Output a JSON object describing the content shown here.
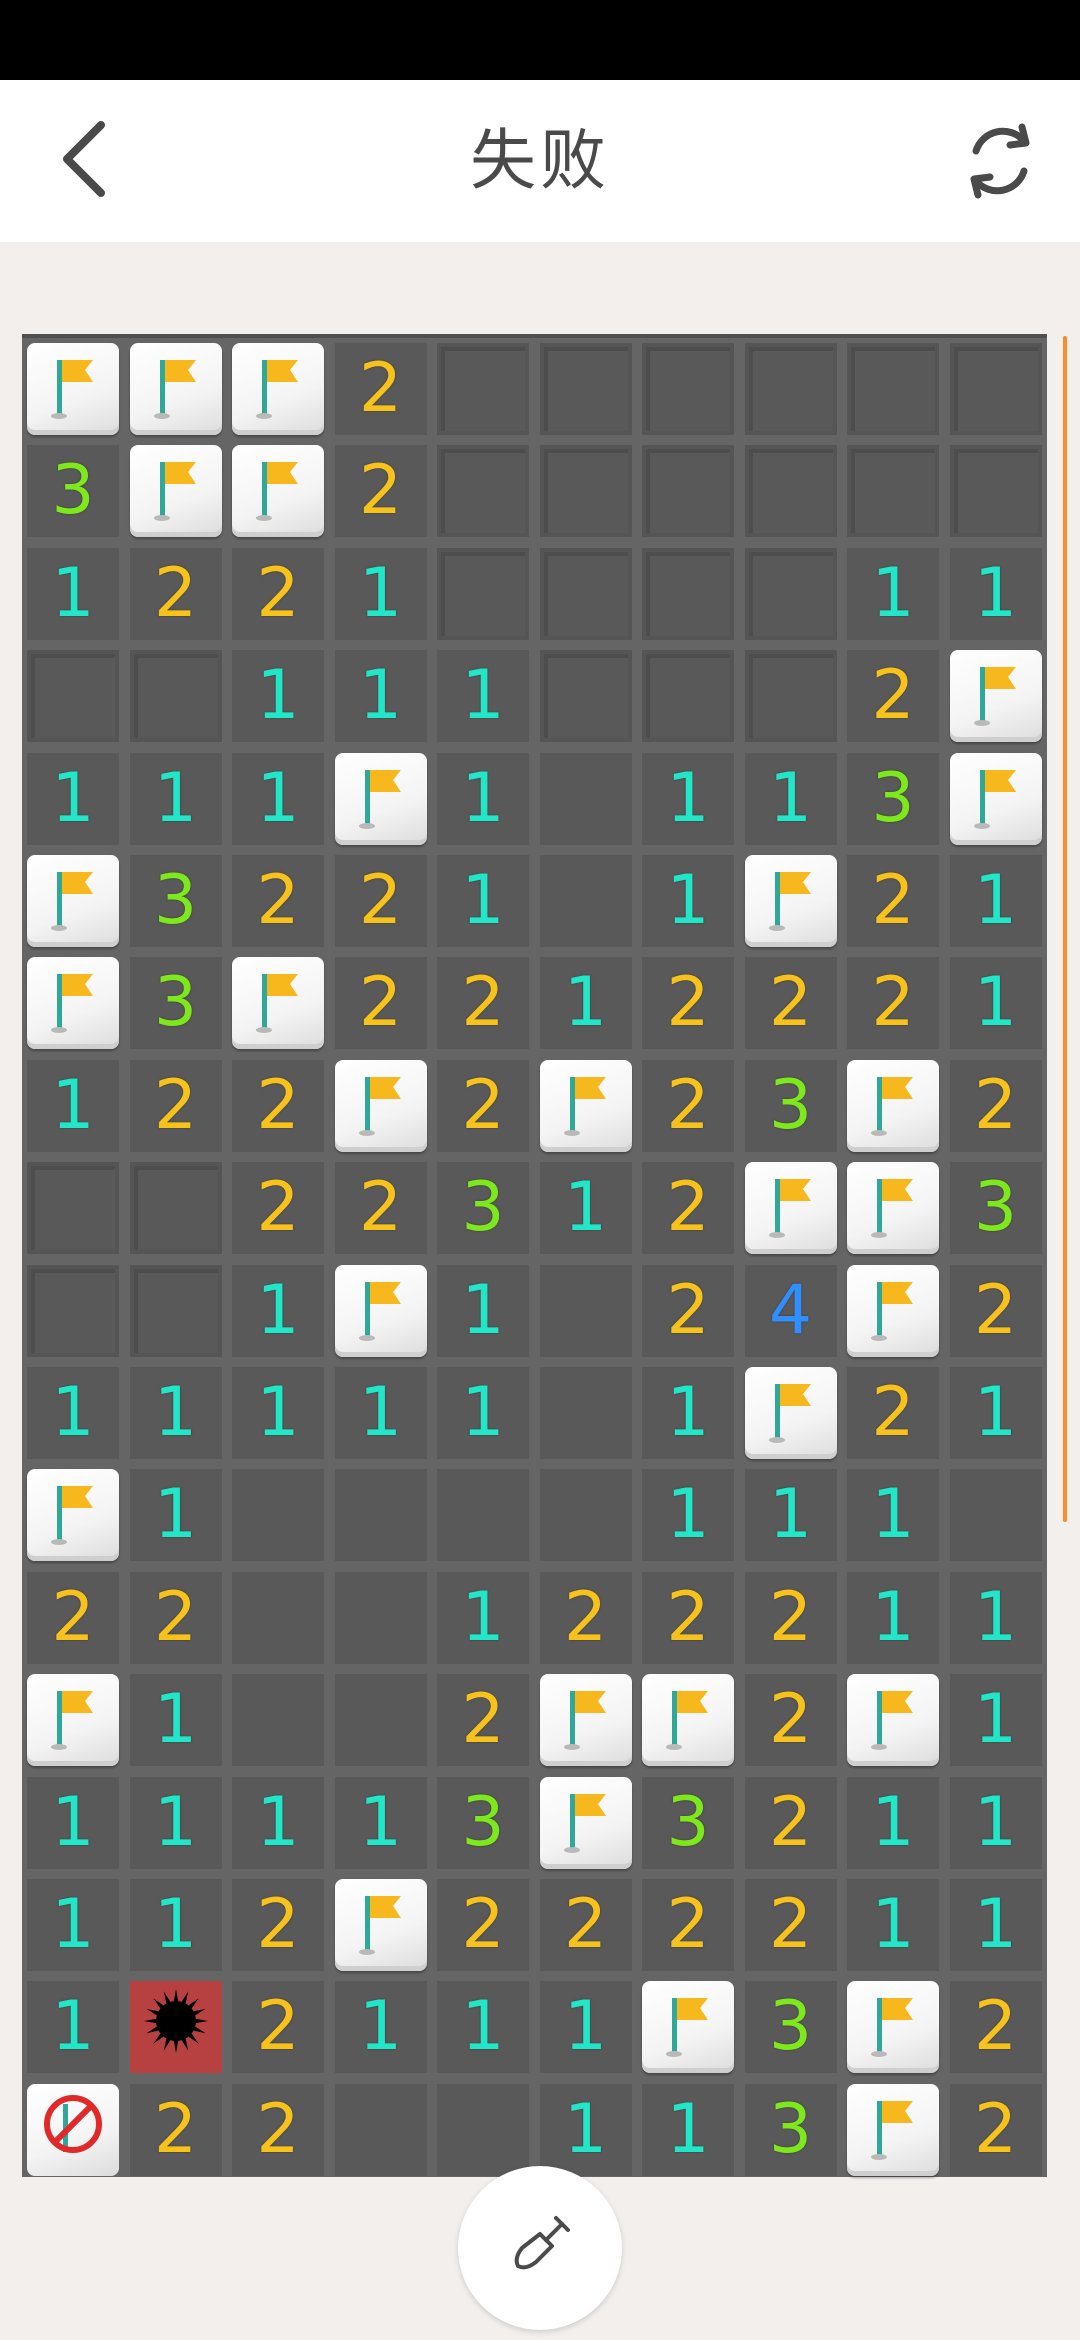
{
  "header": {
    "title": "失败",
    "back_icon": "chevron-left-icon",
    "restart_icon": "refresh-icon"
  },
  "colors": {
    "1": "#22e6c8",
    "2": "#f7c21b",
    "3": "#7de81c",
    "4": "#2f8fff",
    "flag": "#f7b81e",
    "mine_background": "#b74040"
  },
  "board": {
    "columns": 10,
    "rows": 18,
    "legend": "F = flagged, X = exploded mine, W = wrong flag, . = covered, _ = revealed empty",
    "grid": [
      [
        "F",
        "F",
        "F",
        "2",
        ".",
        ".",
        ".",
        ".",
        ".",
        "."
      ],
      [
        "3",
        "F",
        "F",
        "2",
        ".",
        ".",
        ".",
        ".",
        ".",
        "."
      ],
      [
        "1",
        "2",
        "2",
        "1",
        ".",
        ".",
        ".",
        ".",
        "1",
        "1"
      ],
      [
        ".",
        ".",
        "1",
        "1",
        "1",
        ".",
        ".",
        ".",
        "2",
        "F"
      ],
      [
        "1",
        "1",
        "1",
        "F",
        "1",
        "_",
        "1",
        "1",
        "3",
        "F"
      ],
      [
        "F",
        "3",
        "2",
        "2",
        "1",
        "_",
        "1",
        "F",
        "2",
        "1"
      ],
      [
        "F",
        "3",
        "F",
        "2",
        "2",
        "1",
        "2",
        "2",
        "2",
        "1"
      ],
      [
        "1",
        "2",
        "2",
        "F",
        "2",
        "F",
        "2",
        "3",
        "F",
        "2"
      ],
      [
        ".",
        ".",
        "2",
        "2",
        "3",
        "1",
        "2",
        "F",
        "F",
        "3"
      ],
      [
        ".",
        ".",
        "1",
        "F",
        "1",
        "_",
        "2",
        "4",
        "F",
        "2"
      ],
      [
        "1",
        "1",
        "1",
        "1",
        "1",
        "_",
        "1",
        "F",
        "2",
        "1"
      ],
      [
        "F",
        "1",
        "_",
        "_",
        "_",
        "_",
        "1",
        "1",
        "1",
        "_"
      ],
      [
        "2",
        "2",
        "_",
        "_",
        "1",
        "2",
        "2",
        "2",
        "1",
        "1"
      ],
      [
        "F",
        "1",
        "_",
        "_",
        "2",
        "F",
        "F",
        "2",
        "F",
        "1"
      ],
      [
        "1",
        "1",
        "1",
        "1",
        "3",
        "F",
        "3",
        "2",
        "1",
        "1"
      ],
      [
        "1",
        "1",
        "2",
        "F",
        "2",
        "2",
        "2",
        "2",
        "1",
        "1"
      ],
      [
        "1",
        "X",
        "2",
        "1",
        "1",
        "1",
        "F",
        "3",
        "F",
        "2"
      ],
      [
        "W",
        "2",
        "2",
        "_",
        "_",
        "1",
        "1",
        "3",
        "F",
        "2"
      ]
    ]
  },
  "footer": {
    "dig_icon": "shovel-icon"
  }
}
